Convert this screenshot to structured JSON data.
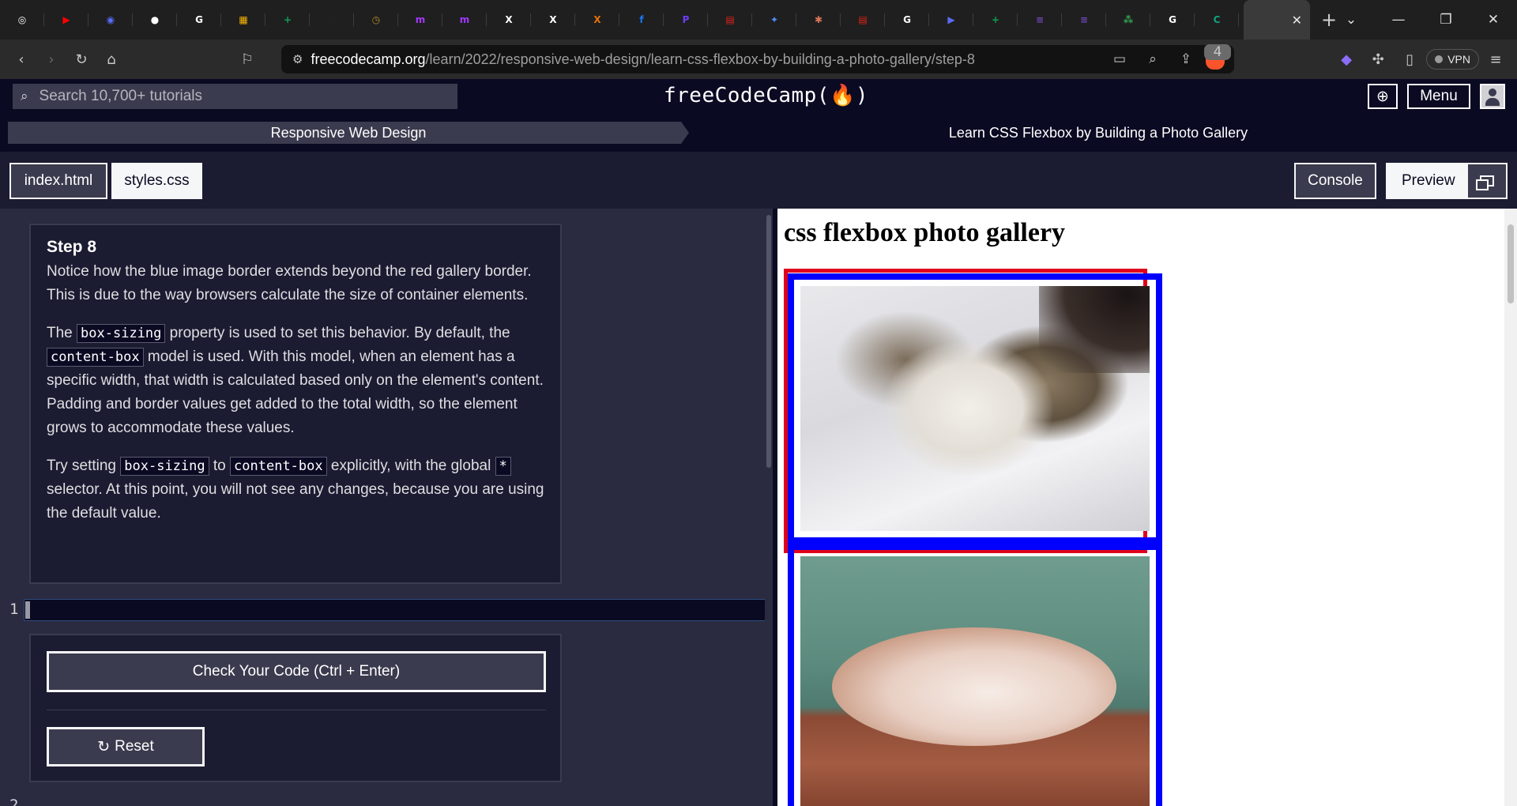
{
  "browser": {
    "tabs": [
      {
        "icon": "openai-icon",
        "color": "#ffffff",
        "glyph": "◎"
      },
      {
        "icon": "youtube-icon",
        "color": "#ff0000",
        "glyph": "▶"
      },
      {
        "icon": "app-icon",
        "color": "#5a6cf5",
        "glyph": "◉"
      },
      {
        "icon": "github-icon",
        "color": "#ffffff",
        "glyph": "●"
      },
      {
        "icon": "google-icon",
        "color": "#ffffff",
        "glyph": "G"
      },
      {
        "icon": "grid-app-icon",
        "color": "#f4b400",
        "glyph": "▦"
      },
      {
        "icon": "sheets-icon",
        "color": "#0f9d58",
        "glyph": "+"
      },
      {
        "icon": "threads-icon",
        "color": "#222222",
        "glyph": "@"
      },
      {
        "icon": "gauge-icon",
        "color": "#b58a2c",
        "glyph": "◷"
      },
      {
        "icon": "m-app-icon",
        "color": "#a238ff",
        "glyph": "m"
      },
      {
        "icon": "m-app-icon",
        "color": "#a238ff",
        "glyph": "m"
      },
      {
        "icon": "x-icon",
        "color": "#ffffff",
        "glyph": "X"
      },
      {
        "icon": "x-icon",
        "color": "#ffffff",
        "glyph": "X"
      },
      {
        "icon": "x-orange-icon",
        "color": "#e8710a",
        "glyph": "X"
      },
      {
        "icon": "facebook-icon",
        "color": "#1877f2",
        "glyph": "f"
      },
      {
        "icon": "p-app-icon",
        "color": "#6b3df5",
        "glyph": "P"
      },
      {
        "icon": "pdf-icon",
        "color": "#e2231a",
        "glyph": "▤"
      },
      {
        "icon": "gemini-icon",
        "color": "#4f8cff",
        "glyph": "✦"
      },
      {
        "icon": "claude-icon",
        "color": "#d97757",
        "glyph": "✱"
      },
      {
        "icon": "pdf-icon",
        "color": "#e2231a",
        "glyph": "▤"
      },
      {
        "icon": "google-icon",
        "color": "#ffffff",
        "glyph": "G"
      },
      {
        "icon": "play-app-icon",
        "color": "#5c6bf5",
        "glyph": "▶"
      },
      {
        "icon": "sheets-icon",
        "color": "#0f9d58",
        "glyph": "+"
      },
      {
        "icon": "forms-icon",
        "color": "#7248b9",
        "glyph": "≡"
      },
      {
        "icon": "forms-icon",
        "color": "#7248b9",
        "glyph": "≡"
      },
      {
        "icon": "colorful-app-icon",
        "color": "#34a853",
        "glyph": "⁂"
      },
      {
        "icon": "google-icon",
        "color": "#ffffff",
        "glyph": "G"
      },
      {
        "icon": "c-app-icon",
        "color": "#10a37f",
        "glyph": "C"
      }
    ],
    "active_tab_close": "✕",
    "new_tab": "+",
    "url_host": "freecodecamp.org",
    "url_path": "/learn/2022/responsive-web-design/learn-css-flexbox-by-building-a-photo-gallery/step-8",
    "extension_badge": "4",
    "vpn_label": "VPN"
  },
  "fcc_nav": {
    "search_placeholder": "Search 10,700+ tutorials",
    "logo": "freeCodeCamp(🔥)",
    "menu_label": "Menu"
  },
  "breadcrumb": {
    "superblock": "Responsive Web Design",
    "block": "Learn CSS Flexbox by Building a Photo Gallery"
  },
  "editor_tabs": {
    "index_label": "index.html",
    "styles_label": "styles.css",
    "console_label": "Console",
    "preview_label": "Preview"
  },
  "instructions": {
    "title": "Step 8",
    "p1": "Notice how the blue image border extends beyond the red gallery border. This is due to the way browsers calculate the size of container elements.",
    "p2_a": "The ",
    "p2_code1": "box-sizing",
    "p2_b": " property is used to set this behavior. By default, the ",
    "p2_code2": "content-box",
    "p2_c": " model is used. With this model, when an element has a specific width, that width is calculated based only on the element's content. Padding and border values get added to the total width, so the element grows to accommodate these values.",
    "p3_a": "Try setting ",
    "p3_code1": "box-sizing",
    "p3_b": " to ",
    "p3_code2": "content-box",
    "p3_c": " explicitly, with the global ",
    "p3_code3": "*",
    "p3_d": " selector. At this point, you will not see any changes, because you are using the default value."
  },
  "editor": {
    "line_number": "1",
    "next_line_number": "2",
    "code_value": ""
  },
  "actions": {
    "check_label": "Check Your Code (Ctrl + Enter)",
    "reset_label": "Reset"
  },
  "preview": {
    "heading": "css flexbox photo gallery",
    "gallery_border_color": "#e0001b",
    "image_border_color": "#0000ff"
  }
}
